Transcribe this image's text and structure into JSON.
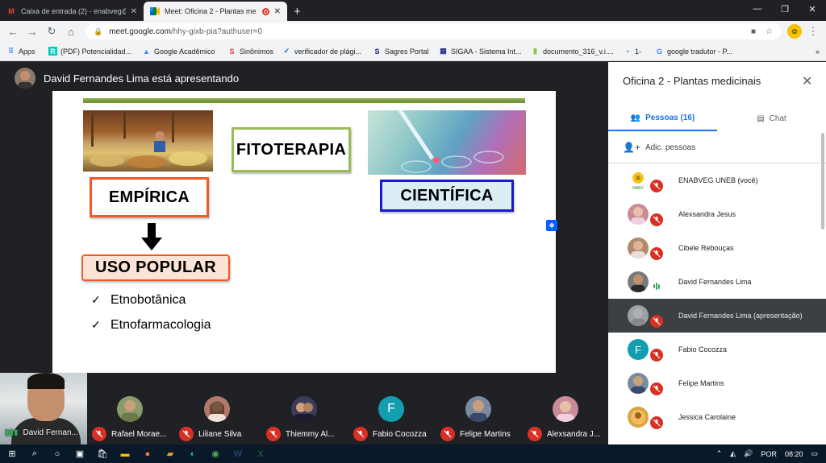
{
  "browser": {
    "tabs": [
      {
        "title": "Caixa de entrada (2) - enabveg@",
        "icon": "gmail-icon",
        "active": false
      },
      {
        "title": "Meet: Oficina 2 - Plantas me",
        "icon": "meet-icon",
        "active": true
      }
    ],
    "new_tab": "+",
    "url_host": "meet.google.com",
    "url_path": "/hhy-gixb-pia?authuser=0",
    "bookmarks": [
      "Apps",
      "(PDF) Potencialidad...",
      "Google Acadêmico",
      "Sinônimos",
      "verificador de plági...",
      "Sagres Portal",
      "SIGAA - Sistema Int...",
      "documento_316_v.i....",
      "1-",
      "google tradutor - P..."
    ]
  },
  "meet": {
    "presenter_text": "David Fernandes Lima está apresentando",
    "slide": {
      "empirica": "EMPÍRICA",
      "fitoterapia": "FITOTERAPIA",
      "cientifica": "CIENTÍFICA",
      "uso_popular": "USO POPULAR",
      "bullets": [
        "Etnobotânica",
        "Etnofarmacologia"
      ]
    },
    "self_name": "David Fernan...",
    "tiles": [
      {
        "name": "Rafael Morae...",
        "color": "#8a9a6a"
      },
      {
        "name": "Liliane Silva",
        "color": "#b07a6a"
      },
      {
        "name": "Thiemmy Al...",
        "color": "#3b3b5a"
      },
      {
        "name": "Fabio Cocozza",
        "color": "#129eaf",
        "initial": "F"
      },
      {
        "name": "Felipe Martins",
        "color": "#7a8aa0"
      },
      {
        "name": "Alexsandra J...",
        "color": "#c98a9a"
      }
    ]
  },
  "panel": {
    "title": "Oficina 2 - Plantas medicinais",
    "tab_people": "Pessoas (16)",
    "tab_chat": "Chat",
    "add_people": "Adic. pessoas",
    "people": [
      {
        "name": "ENABVEG UNEB (você)",
        "color": "#f5c518",
        "initial": "",
        "muted": true
      },
      {
        "name": "Alexsandra Jesus",
        "color": "#c98a9a",
        "initial": "",
        "muted": true
      },
      {
        "name": "Cibele Rebouças",
        "color": "#b08a6a",
        "initial": "",
        "muted": true
      },
      {
        "name": "David Fernandes Lima",
        "color": "#7a7a7a",
        "initial": "",
        "muted": false
      },
      {
        "name": "David Fernandes Lima (apresentação)",
        "color": "#9aa0a6",
        "initial": "",
        "muted": true
      },
      {
        "name": "Fabio Cocozza",
        "color": "#129eaf",
        "initial": "F",
        "muted": true
      },
      {
        "name": "Felipe Martins",
        "color": "#7a8aa0",
        "initial": "",
        "muted": true
      },
      {
        "name": "Jessica Carolaine",
        "color": "#d9a441",
        "initial": "",
        "muted": true
      }
    ]
  },
  "taskbar": {
    "lang": "POR",
    "time": "08:20"
  }
}
